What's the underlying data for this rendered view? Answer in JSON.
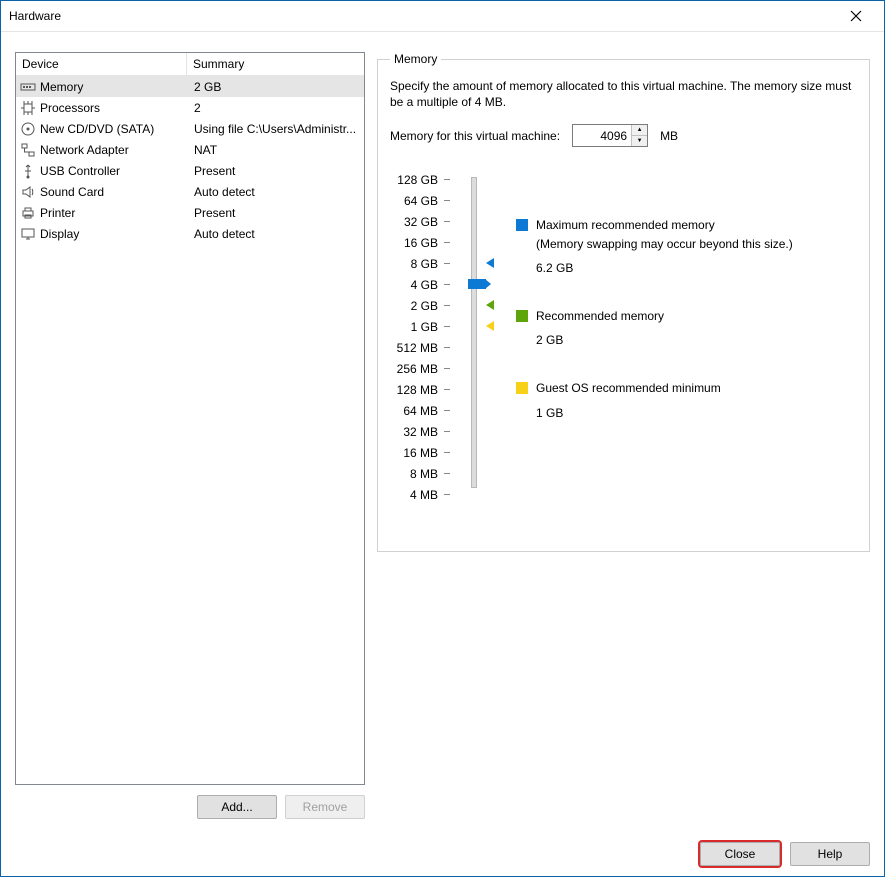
{
  "window": {
    "title": "Hardware"
  },
  "device_table": {
    "columns": {
      "c1": "Device",
      "c2": "Summary"
    },
    "rows": [
      {
        "icon": "memory-icon",
        "name": "Memory",
        "summary": "2 GB",
        "selected": true
      },
      {
        "icon": "cpu-icon",
        "name": "Processors",
        "summary": "2"
      },
      {
        "icon": "disc-icon",
        "name": "New CD/DVD (SATA)",
        "summary": "Using file C:\\Users\\Administr..."
      },
      {
        "icon": "network-icon",
        "name": "Network Adapter",
        "summary": "NAT"
      },
      {
        "icon": "usb-icon",
        "name": "USB Controller",
        "summary": "Present"
      },
      {
        "icon": "sound-icon",
        "name": "Sound Card",
        "summary": "Auto detect"
      },
      {
        "icon": "printer-icon",
        "name": "Printer",
        "summary": "Present"
      },
      {
        "icon": "display-icon",
        "name": "Display",
        "summary": "Auto detect"
      }
    ]
  },
  "buttons": {
    "add": "Add...",
    "remove": "Remove",
    "close": "Close",
    "help": "Help"
  },
  "memory_panel": {
    "legend": "Memory",
    "description": "Specify the amount of memory allocated to this virtual machine. The memory size must be a multiple of 4 MB.",
    "input_label": "Memory for this virtual machine:",
    "input_value": "4096",
    "unit": "MB",
    "ticks": [
      "128 GB",
      "64 GB",
      "32 GB",
      "16 GB",
      "8 GB",
      "4 GB",
      "2 GB",
      "1 GB",
      "512 MB",
      "256 MB",
      "128 MB",
      "64 MB",
      "32 MB",
      "16 MB",
      "8 MB",
      "4 MB"
    ],
    "slider_index": 5,
    "markers": {
      "blue_index": 4,
      "green_index": 6,
      "yellow_index": 7
    },
    "legend_items": {
      "max": {
        "title": "Maximum recommended memory",
        "sub": "(Memory swapping may occur beyond this size.)",
        "value": "6.2 GB"
      },
      "rec": {
        "title": "Recommended memory",
        "value": "2 GB"
      },
      "guest": {
        "title": "Guest OS recommended minimum",
        "value": "1 GB"
      }
    }
  }
}
